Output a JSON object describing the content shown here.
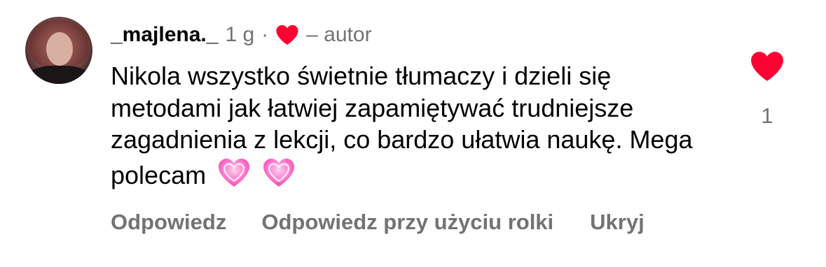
{
  "comment": {
    "username": "_majlena._",
    "time": "1 g",
    "separator": "·",
    "author_label": "– autor",
    "text": "Nikola wszystko świetnie tłumaczy i dzieli się metodami  jak łatwiej zapamiętywać trudniejsze zagadnienia z lekcji, co bardzo ułatwia naukę. Mega polecam",
    "emojis": [
      "pink-heart-emoji",
      "pink-heart-emoji"
    ],
    "like_count": "1",
    "colors": {
      "heart": "#ff0033",
      "muted": "#737373",
      "text": "#000000",
      "emoji_pink": "#ff5fbf"
    },
    "icons": {
      "author_heart": "heart-icon",
      "like": "heart-icon",
      "avatar": "avatar"
    }
  },
  "actions": {
    "reply": "Odpowiedz",
    "reply_reel": "Odpowiedz przy użyciu rolki",
    "hide": "Ukryj"
  }
}
